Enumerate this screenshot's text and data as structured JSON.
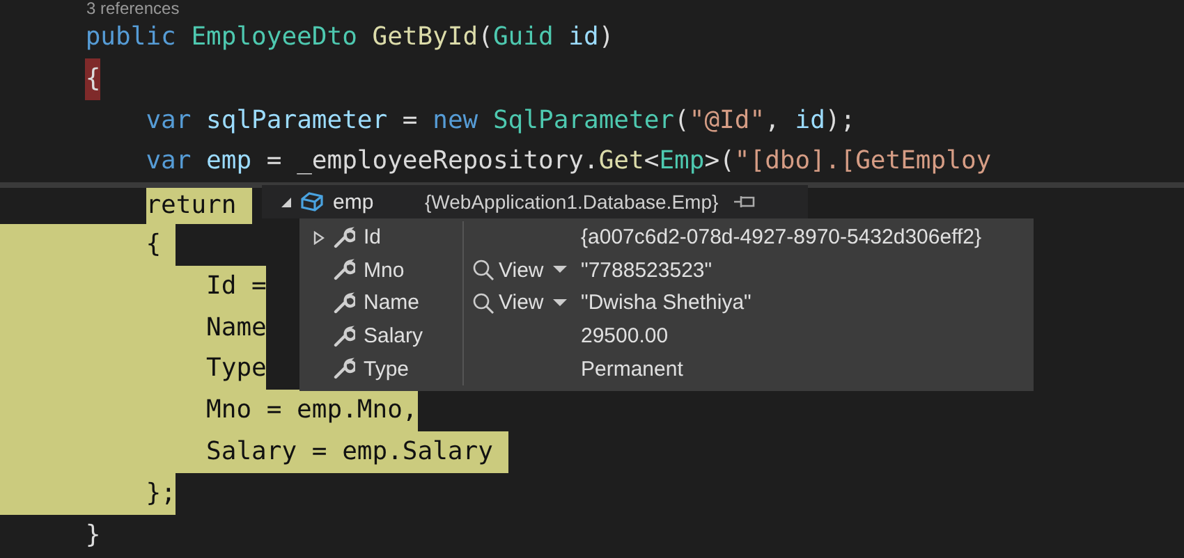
{
  "editor": {
    "codelens": "3 references",
    "lines": [
      {
        "kind": "member",
        "current": false,
        "highlighted": false,
        "tokens": [
          {
            "kind": "keyword",
            "text": "public "
          },
          {
            "kind": "type",
            "text": "EmployeeDto "
          },
          {
            "kind": "method",
            "text": "GetById"
          },
          {
            "kind": "plain",
            "text": "("
          },
          {
            "kind": "type",
            "text": "Guid "
          },
          {
            "kind": "variable",
            "text": "id"
          },
          {
            "kind": "plain",
            "text": ")"
          }
        ]
      },
      {
        "kind": "member",
        "current": false,
        "highlighted": false,
        "tokens": [
          {
            "kind": "plain",
            "text": "{",
            "matched": true
          }
        ]
      },
      {
        "kind": "statement",
        "current": false,
        "highlighted": false,
        "tokens": [
          {
            "kind": "keyword",
            "text": "var "
          },
          {
            "kind": "variable",
            "text": "sqlParameter"
          },
          {
            "kind": "plain",
            "text": " = "
          },
          {
            "kind": "keyword",
            "text": "new "
          },
          {
            "kind": "type",
            "text": "SqlParameter"
          },
          {
            "kind": "plain",
            "text": "("
          },
          {
            "kind": "string",
            "text": "\"@Id\""
          },
          {
            "kind": "plain",
            "text": ", "
          },
          {
            "kind": "variable",
            "text": "id"
          },
          {
            "kind": "plain",
            "text": ");"
          }
        ]
      },
      {
        "kind": "statement",
        "current": false,
        "highlighted": false,
        "tokens": [
          {
            "kind": "keyword",
            "text": "var "
          },
          {
            "kind": "variable",
            "text": "emp"
          },
          {
            "kind": "plain",
            "text": " = "
          },
          {
            "kind": "field",
            "text": "_employeeRepository"
          },
          {
            "kind": "plain",
            "text": "."
          },
          {
            "kind": "method",
            "text": "Get"
          },
          {
            "kind": "plain",
            "text": "<"
          },
          {
            "kind": "type",
            "text": "Emp"
          },
          {
            "kind": "plain",
            "text": ">("
          },
          {
            "kind": "string",
            "text": "\"[dbo].[GetEmploy"
          }
        ]
      },
      {
        "kind": "statement",
        "current": true,
        "highlighted": true,
        "tokens": [
          {
            "kind": "keyword",
            "text": "return "
          }
        ]
      },
      {
        "kind": "statement",
        "current": false,
        "highlighted": true,
        "tokens": [
          {
            "kind": "plain",
            "text": "{ "
          }
        ]
      },
      {
        "kind": "initializer",
        "current": false,
        "highlighted": true,
        "tokens": [
          {
            "kind": "plain",
            "text": "Id ="
          }
        ]
      },
      {
        "kind": "initializer",
        "current": false,
        "highlighted": true,
        "tokens": [
          {
            "kind": "plain",
            "text": "Name"
          }
        ]
      },
      {
        "kind": "initializer",
        "current": false,
        "highlighted": true,
        "tokens": [
          {
            "kind": "plain",
            "text": "Type"
          }
        ]
      },
      {
        "kind": "initializer",
        "current": false,
        "highlighted": true,
        "tokens": [
          {
            "kind": "plain",
            "text": "Mno = emp.Mno,"
          }
        ]
      },
      {
        "kind": "initializer",
        "current": false,
        "highlighted": true,
        "tokens": [
          {
            "kind": "plain",
            "text": "Salary = emp.Salary "
          }
        ]
      },
      {
        "kind": "statement",
        "current": false,
        "highlighted": true,
        "tokens": [
          {
            "kind": "plain",
            "text": "};"
          }
        ]
      },
      {
        "kind": "member",
        "current": false,
        "highlighted": false,
        "tokens": [
          {
            "kind": "plain",
            "text": "}"
          }
        ]
      }
    ]
  },
  "datatip": {
    "name": "emp",
    "type": "{WebApplication1.Database.Emp}",
    "rows": [
      {
        "name": "Id",
        "expandable": true,
        "value": "{a007c6d2-078d-4927-8970-5432d306eff2}"
      },
      {
        "name": "Mno",
        "expandable": false,
        "visualizer": "View",
        "value": "\"7788523523\""
      },
      {
        "name": "Name",
        "expandable": false,
        "visualizer": "View",
        "value": "\"Dwisha Shethiya\""
      },
      {
        "name": "Salary",
        "expandable": false,
        "value": "29500.00"
      },
      {
        "name": "Type",
        "expandable": false,
        "value": "Permanent"
      }
    ]
  }
}
